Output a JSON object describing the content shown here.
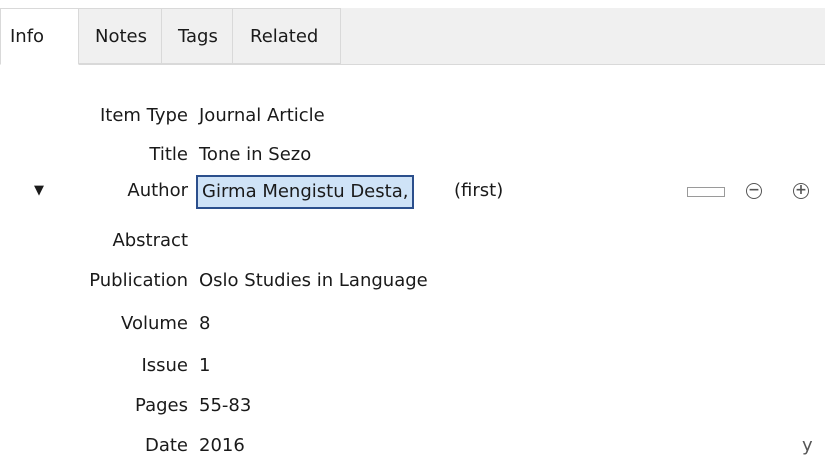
{
  "tabs": [
    {
      "label": "Info",
      "selected": true
    },
    {
      "label": "Notes",
      "selected": false
    },
    {
      "label": "Tags",
      "selected": false
    },
    {
      "label": "Related",
      "selected": false
    }
  ],
  "fields": {
    "item_type": {
      "label": "Item Type",
      "value": "Journal Article"
    },
    "title": {
      "label": "Title",
      "value": "Tone in Sezo"
    },
    "author": {
      "label": "Author",
      "name": "Girma Mengistu Desta,",
      "creator_type": "(first)",
      "twisty_icon": "disclosure-triangle-down",
      "switch_icon": "single-field-toggle",
      "remove_icon": "minus-circle",
      "add_icon": "plus-circle"
    },
    "abstract": {
      "label": "Abstract",
      "value": ""
    },
    "publication": {
      "label": "Publication",
      "value": "Oslo Studies in Language"
    },
    "volume": {
      "label": "Volume",
      "value": "8"
    },
    "issue": {
      "label": "Issue",
      "value": "1"
    },
    "pages": {
      "label": "Pages",
      "value": "55-83"
    },
    "date": {
      "label": "Date",
      "value": "2016",
      "suffix": "y"
    }
  },
  "colors": {
    "selection_border": "#2b4f8c",
    "selection_fill": "#cfe3f7",
    "tabstrip_bg": "#f0f0f0"
  }
}
